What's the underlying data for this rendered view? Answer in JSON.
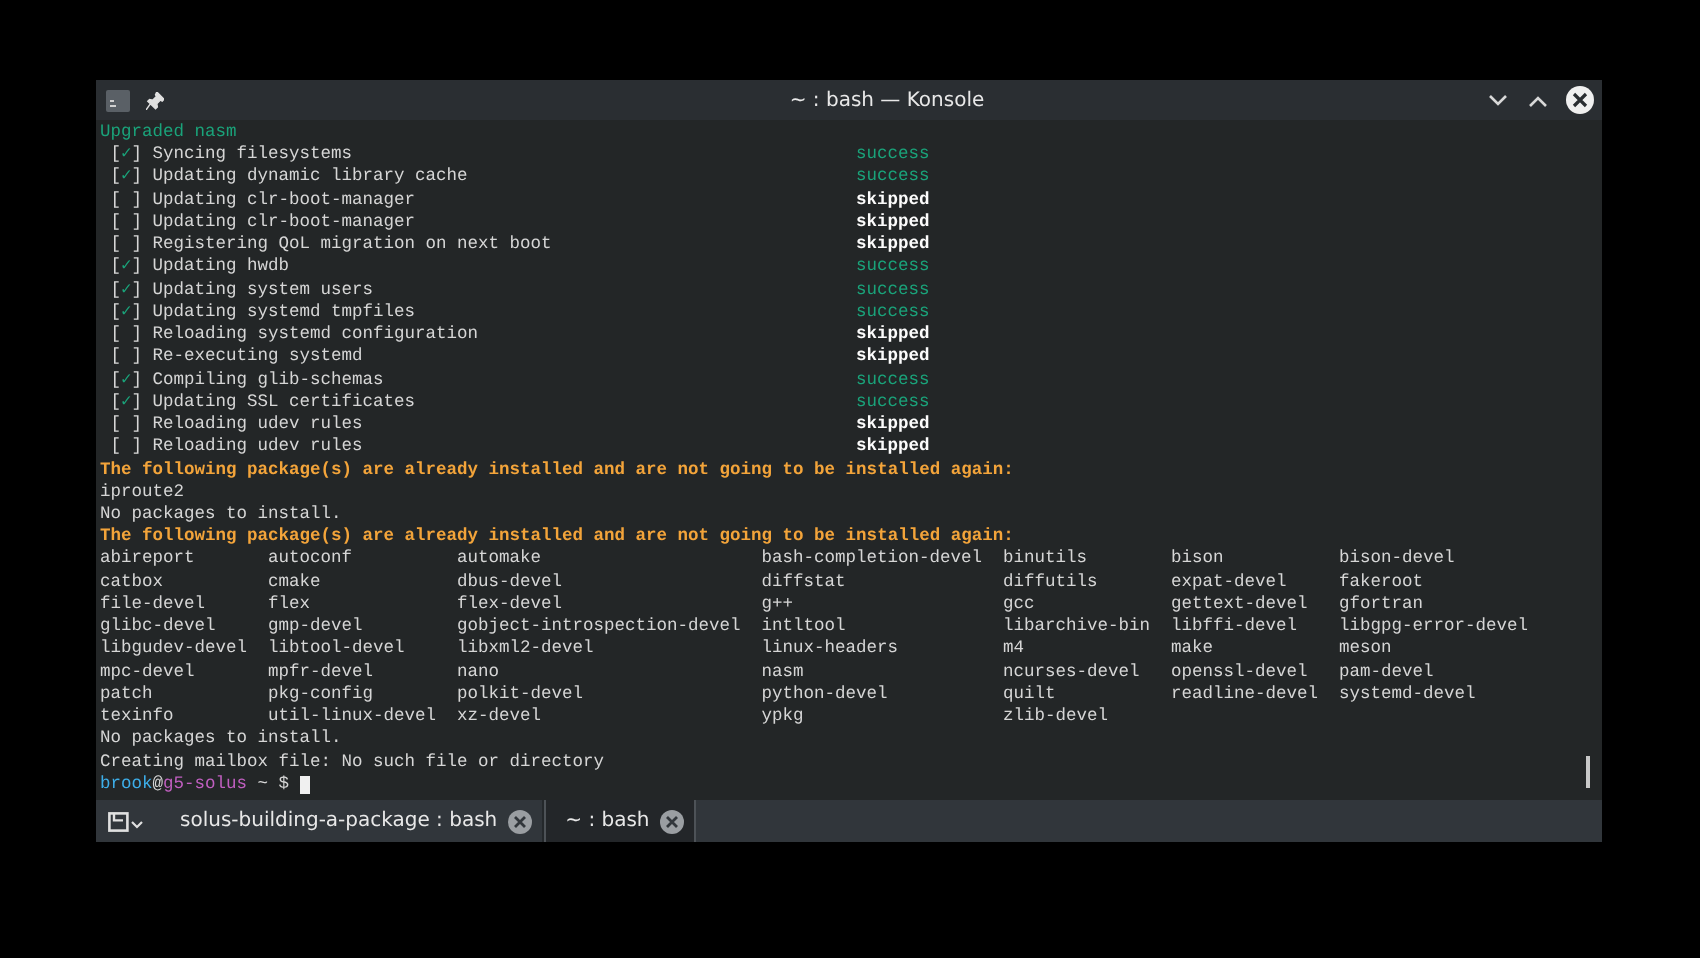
{
  "window": {
    "title": "~ : bash — Konsole"
  },
  "output": [
    {
      "kind": "heading",
      "text": "Upgraded nasm"
    },
    {
      "kind": "step",
      "box": "[✓]",
      "label": "Syncing filesystems",
      "status": "success",
      "ok": true
    },
    {
      "kind": "step",
      "box": "[✓]",
      "label": "Updating dynamic library cache",
      "status": "success",
      "ok": true
    },
    {
      "kind": "step",
      "box": "[ ]",
      "label": "Updating clr-boot-manager",
      "status": "skipped",
      "ok": false
    },
    {
      "kind": "step",
      "box": "[ ]",
      "label": "Updating clr-boot-manager",
      "status": "skipped",
      "ok": false
    },
    {
      "kind": "step",
      "box": "[ ]",
      "label": "Registering QoL migration on next boot",
      "status": "skipped",
      "ok": false
    },
    {
      "kind": "step",
      "box": "[✓]",
      "label": "Updating hwdb",
      "status": "success",
      "ok": true
    },
    {
      "kind": "step",
      "box": "[✓]",
      "label": "Updating system users",
      "status": "success",
      "ok": true
    },
    {
      "kind": "step",
      "box": "[✓]",
      "label": "Updating systemd tmpfiles",
      "status": "success",
      "ok": true
    },
    {
      "kind": "step",
      "box": "[ ]",
      "label": "Reloading systemd configuration",
      "status": "skipped",
      "ok": false
    },
    {
      "kind": "step",
      "box": "[ ]",
      "label": "Re-executing systemd",
      "status": "skipped",
      "ok": false
    },
    {
      "kind": "step",
      "box": "[✓]",
      "label": "Compiling glib-schemas",
      "status": "success",
      "ok": true
    },
    {
      "kind": "step",
      "box": "[✓]",
      "label": "Updating SSL certificates",
      "status": "success",
      "ok": true
    },
    {
      "kind": "step",
      "box": "[ ]",
      "label": "Reloading udev rules",
      "status": "skipped",
      "ok": false
    },
    {
      "kind": "step",
      "box": "[ ]",
      "label": "Reloading udev rules",
      "status": "skipped",
      "ok": false
    },
    {
      "kind": "warning",
      "text": "The following package(s) are already installed and are not going to be installed again:"
    },
    {
      "kind": "plain",
      "text": "iproute2"
    },
    {
      "kind": "plain",
      "text": "No packages to install."
    },
    {
      "kind": "warning",
      "text": "The following package(s) are already installed and are not going to be installed again:"
    },
    {
      "kind": "packages",
      "rows": [
        [
          "abireport",
          "autoconf",
          "automake",
          "bash-completion-devel",
          "binutils",
          "bison",
          "bison-devel"
        ],
        [
          "catbox",
          "cmake",
          "dbus-devel",
          "diffstat",
          "diffutils",
          "expat-devel",
          "fakeroot"
        ],
        [
          "file-devel",
          "flex",
          "flex-devel",
          "g++",
          "gcc",
          "gettext-devel",
          "gfortran"
        ],
        [
          "glibc-devel",
          "gmp-devel",
          "gobject-introspection-devel",
          "intltool",
          "libarchive-bin",
          "libffi-devel",
          "libgpg-error-devel"
        ],
        [
          "libgudev-devel",
          "libtool-devel",
          "libxml2-devel",
          "linux-headers",
          "m4",
          "make",
          "meson"
        ],
        [
          "mpc-devel",
          "mpfr-devel",
          "nano",
          "nasm",
          "ncurses-devel",
          "openssl-devel",
          "pam-devel"
        ],
        [
          "patch",
          "pkg-config",
          "polkit-devel",
          "python-devel",
          "quilt",
          "readline-devel",
          "systemd-devel"
        ],
        [
          "texinfo",
          "util-linux-devel",
          "xz-devel",
          "ypkg",
          "zlib-devel"
        ]
      ]
    },
    {
      "kind": "plain",
      "text": "No packages to install."
    },
    {
      "kind": "plain",
      "text": "Creating mailbox file: No such file or directory"
    },
    {
      "kind": "prompt",
      "user": "brook",
      "at": "@",
      "host": "g5-solus",
      "rest": " ~ $ "
    }
  ],
  "tabs": [
    {
      "label": "solus-building-a-package : bash",
      "selected": false
    },
    {
      "label": "~ : bash",
      "selected": true
    }
  ]
}
